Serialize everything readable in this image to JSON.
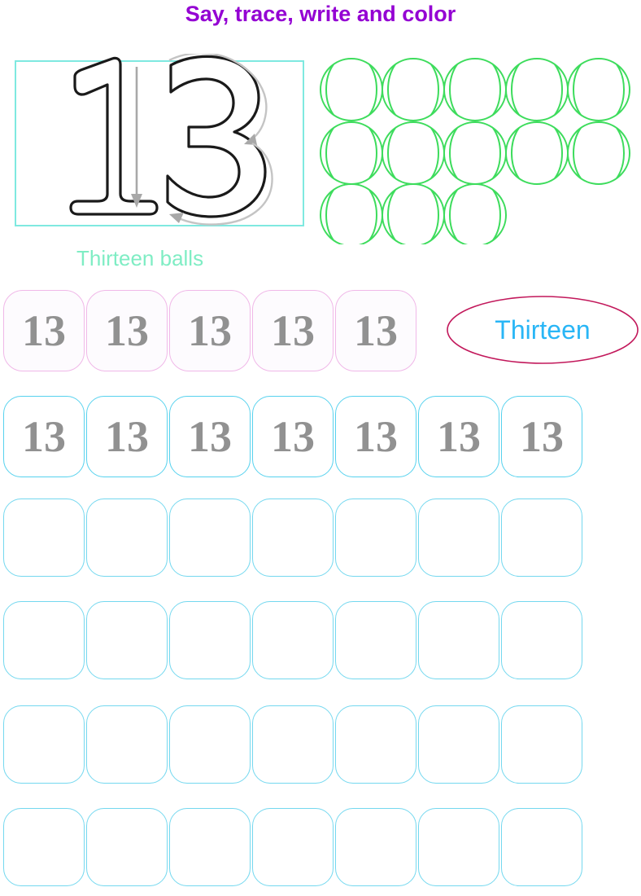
{
  "title": "Say, trace, write and color",
  "colors": {
    "title_purple": "#9400d3",
    "hero_box_border": "#7fe9e0",
    "ball_green": "#3ddc5c",
    "caption_mint": "#7fedc4",
    "pink_border": "#f0b8e8",
    "cyan_border": "#57d2ee",
    "number_gray": "#919191",
    "ellipse_crimson": "#c2185b",
    "word_cyan": "#29b6f6",
    "trace_arrow_gray": "#a0a0a0",
    "outline_black": "#1a1a1a"
  },
  "hero": {
    "number": "13",
    "trace_arrow_1": "down-arrow-icon",
    "trace_arrow_2": "curve-arrow-icon",
    "trace_arrow_3": "curve-arrow-icon"
  },
  "illustration": {
    "item_name": "ball",
    "count": 13,
    "rows": [
      5,
      5,
      3
    ],
    "caption": "Thirteen balls"
  },
  "word_bubble": {
    "word": "Thirteen",
    "shape": "ellipse"
  },
  "practice_rows": [
    {
      "id": "trace-pink",
      "style": "pink",
      "count": 5,
      "values": [
        "13",
        "13",
        "13",
        "13",
        "13"
      ]
    },
    {
      "id": "trace-cyan",
      "style": "cyan",
      "count": 7,
      "values": [
        "13",
        "13",
        "13",
        "13",
        "13",
        "13",
        "13"
      ]
    },
    {
      "id": "blank-1",
      "style": "cyan-thin",
      "count": 7,
      "values": [
        "",
        "",
        "",
        "",
        "",
        "",
        ""
      ]
    },
    {
      "id": "blank-2",
      "style": "cyan-thin",
      "count": 7,
      "values": [
        "",
        "",
        "",
        "",
        "",
        "",
        ""
      ]
    },
    {
      "id": "blank-3",
      "style": "cyan-thin",
      "count": 7,
      "values": [
        "",
        "",
        "",
        "",
        "",
        "",
        ""
      ]
    },
    {
      "id": "blank-4",
      "style": "cyan-thin",
      "count": 7,
      "values": [
        "",
        "",
        "",
        "",
        "",
        "",
        ""
      ]
    }
  ]
}
